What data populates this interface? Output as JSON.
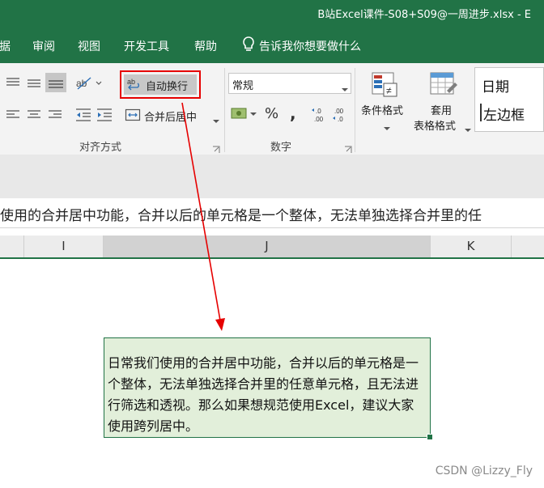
{
  "window": {
    "title": "B站Excel课件-S08+S09@一周进步.xlsx  -  E"
  },
  "menu": {
    "items": [
      "据",
      "审阅",
      "视图",
      "开发工具",
      "帮助"
    ],
    "tell_me": "告诉我你想要做什么"
  },
  "ribbon": {
    "wrap_text": "自动换行",
    "merge_center": "合并后居中",
    "number_format": "常规",
    "percent": "%",
    "comma": ",",
    "conditional_format": "条件格式",
    "table_format_line1": "套用",
    "table_format_line2": "表格格式",
    "style_date": "日期",
    "style_left_border": "左边框",
    "group_alignment": "对齐方式",
    "group_number": "数字"
  },
  "formula_bar": {
    "text": "使用的合并居中功能，合并以后的单元格是一个整体，无法单独选择合并里的任"
  },
  "columns": [
    "I",
    "J",
    "K"
  ],
  "cell": {
    "text": "日常我们使用的合并居中功能，合并以后的单元格是一个整体，无法单独选择合并里的任意单元格，且无法进行筛选和透视。那么如果想规范使用Excel，建议大家使用跨列居中。"
  },
  "watermark": "CSDN @Lizzy_Fly",
  "colors": {
    "excel_green": "#217346",
    "highlight_red": "#e60000",
    "cell_fill": "#e2efda"
  }
}
